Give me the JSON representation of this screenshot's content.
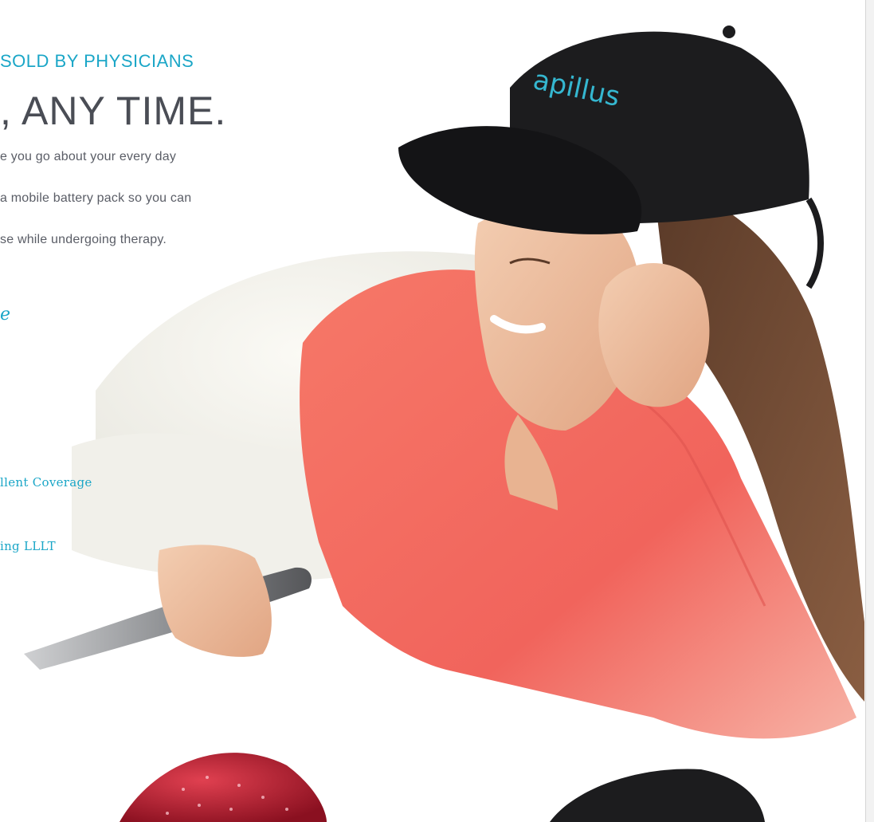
{
  "subheading": "SOLD BY PHYSICIANS",
  "headline": ", ANY TIME.",
  "body_lines": [
    "e you go about your every day",
    "a mobile battery pack so you can",
    "se while undergoing therapy."
  ],
  "script_fragment": "e",
  "features": [
    "llent Coverage",
    "ing  LLLT"
  ],
  "cap_logo": "apillus",
  "colors": {
    "accent_teal": "#1aa6c7",
    "headline_gray": "#4a4d55",
    "body_gray": "#5a5d66",
    "sweater_coral": "#f2685f",
    "cap_black": "#1c1c1e"
  }
}
